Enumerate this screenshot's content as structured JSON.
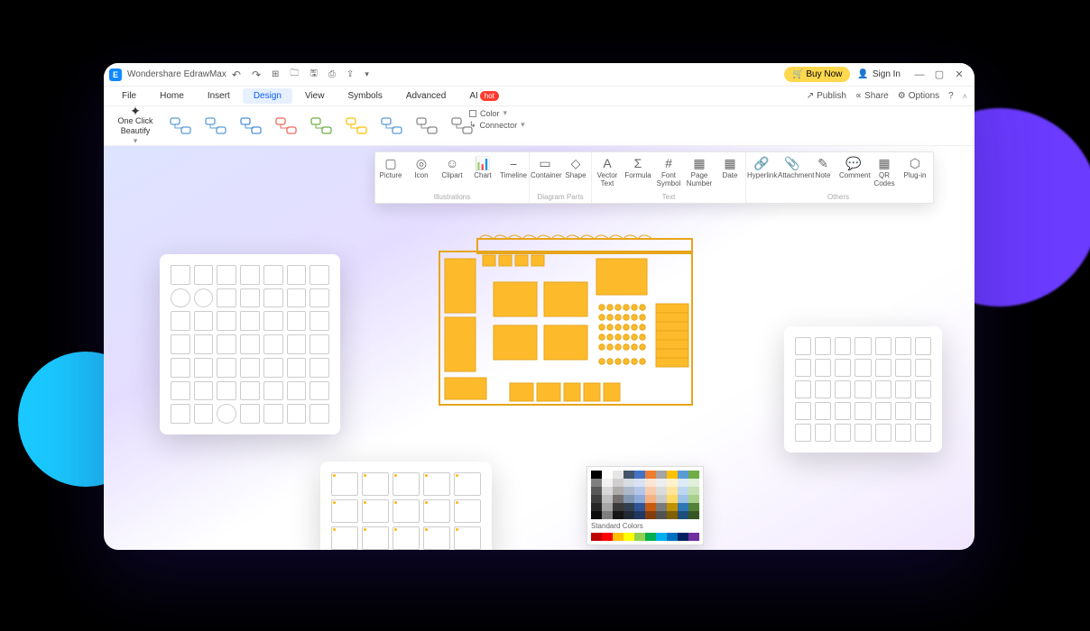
{
  "app": {
    "title": "Wondershare EdrawMax"
  },
  "titlebar": {
    "buy_label": "Buy Now",
    "signin_label": "Sign In"
  },
  "menu": {
    "items": [
      "File",
      "Home",
      "Insert",
      "Design",
      "View",
      "Symbols",
      "Advanced"
    ],
    "ai_label": "AI",
    "ai_badge": "hot",
    "active_index": 3,
    "right": [
      "Publish",
      "Share",
      "Options"
    ]
  },
  "ribbon": {
    "beautify_line1": "One Click",
    "beautify_line2": "Beautify",
    "fill_label": "Color",
    "connector_label": "Connector"
  },
  "insert_ribbon": {
    "groups": [
      {
        "label": "Illustrations",
        "tools": [
          "Picture",
          "Icon",
          "Clipart",
          "Chart",
          "Timeline"
        ]
      },
      {
        "label": "Diagram Parts",
        "tools": [
          "Container",
          "Shape"
        ]
      },
      {
        "label": "Text",
        "tools": [
          "Vector Text",
          "Formula",
          "Font Symbol",
          "Page Number",
          "Date"
        ]
      },
      {
        "label": "Others",
        "tools": [
          "Hyperlink",
          "Attachment",
          "Note",
          "Comment",
          "QR Codes",
          "Plug-in"
        ]
      }
    ],
    "icons": {
      "Picture": "▢",
      "Icon": "◎",
      "Clipart": "☺",
      "Chart": "📊",
      "Timeline": "⎯",
      "Container": "▭",
      "Shape": "◇",
      "Vector Text": "A",
      "Formula": "Σ",
      "Font Symbol": "#",
      "Page Number": "▦",
      "Date": "▦",
      "Hyperlink": "🔗",
      "Attachment": "📎",
      "Note": "✎",
      "Comment": "💬",
      "QR Codes": "▦",
      "Plug-in": "⬡"
    }
  },
  "color_picker": {
    "standard_label": "Standard Colors"
  },
  "shape_colors": [
    "#5b9bd5",
    "#5b9bd5",
    "#4a90d9",
    "#ed6a5e",
    "#70ad47",
    "#ffc000",
    "#5b9bd5",
    "#888",
    "#888"
  ],
  "theme_colors": [
    [
      "#000000",
      "#ffffff",
      "#e7e6e6",
      "#44546a",
      "#4472c4",
      "#ed7d31",
      "#a5a5a5",
      "#ffc000",
      "#5b9bd5",
      "#70ad47"
    ],
    [
      "#7f7f7f",
      "#f2f2f2",
      "#d0cece",
      "#d6dce4",
      "#d9e2f3",
      "#fbe5d5",
      "#ededed",
      "#fff2cc",
      "#deebf6",
      "#e2efd9"
    ],
    [
      "#595959",
      "#d8d8d8",
      "#aeabab",
      "#adb9ca",
      "#b4c6e7",
      "#f7cbac",
      "#dbdbdb",
      "#fee599",
      "#bdd7ee",
      "#c5e0b3"
    ],
    [
      "#3f3f3f",
      "#bfbfbf",
      "#757070",
      "#8496b0",
      "#8eaadb",
      "#f4b183",
      "#c9c9c9",
      "#ffd965",
      "#9cc3e5",
      "#a8d08d"
    ],
    [
      "#262626",
      "#a5a5a5",
      "#3a3838",
      "#323f4f",
      "#2f5496",
      "#c55a11",
      "#7b7b7b",
      "#bf9000",
      "#2e75b5",
      "#538135"
    ],
    [
      "#0c0c0c",
      "#7f7f7f",
      "#171616",
      "#222a35",
      "#1f3864",
      "#833c0b",
      "#525252",
      "#7f6000",
      "#1e4e79",
      "#375623"
    ]
  ],
  "standard_colors": [
    "#c00000",
    "#ff0000",
    "#ffc000",
    "#ffff00",
    "#92d050",
    "#00b050",
    "#00b0f0",
    "#0070c0",
    "#002060",
    "#7030a0"
  ]
}
